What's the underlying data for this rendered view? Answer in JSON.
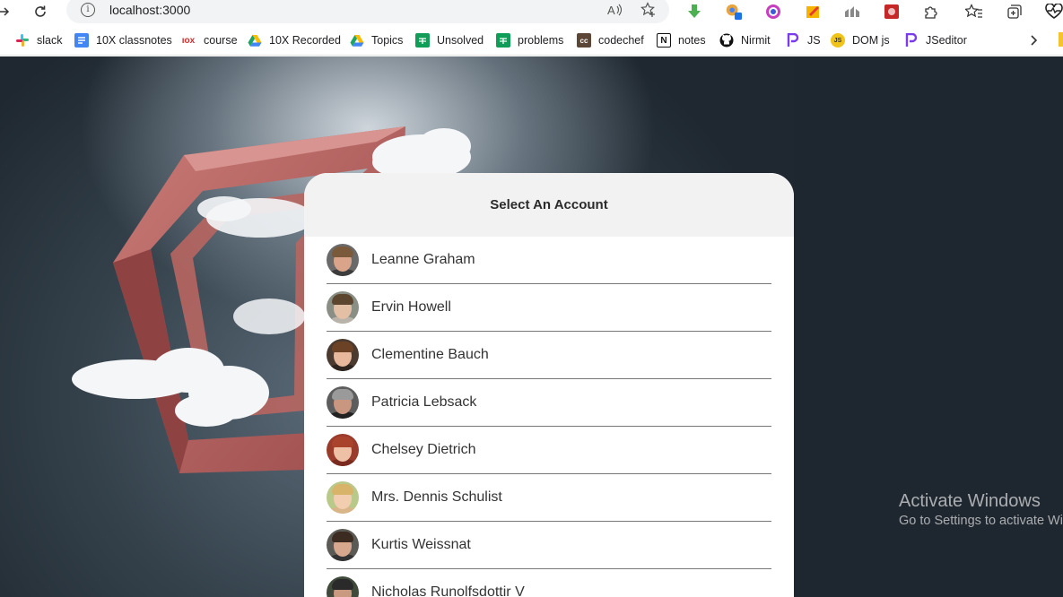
{
  "browser": {
    "url": "localhost:3000",
    "bookmarks": [
      {
        "label": "slack",
        "icon": "slack-icon"
      },
      {
        "label": "10X classnotes",
        "icon": "google-docs-icon"
      },
      {
        "label": "course",
        "icon": "10x-icon"
      },
      {
        "label": "10X Recorded",
        "icon": "google-drive-icon"
      },
      {
        "label": "Topics",
        "icon": "google-drive-icon"
      },
      {
        "label": "Unsolved",
        "icon": "google-sheets-icon"
      },
      {
        "label": "problems",
        "icon": "google-sheets-icon"
      },
      {
        "label": "codechef",
        "icon": "codechef-icon"
      },
      {
        "label": "notes",
        "icon": "notion-icon"
      },
      {
        "label": "Nirmit",
        "icon": "github-icon"
      },
      {
        "label": "JS",
        "icon": "jseditor-icon"
      },
      {
        "label": "DOM js",
        "icon": "js-icon"
      },
      {
        "label": "JSeditor",
        "icon": "jseditor-icon"
      }
    ]
  },
  "card": {
    "title": "Select An Account",
    "accounts": [
      {
        "name": "Leanne Graham"
      },
      {
        "name": "Ervin Howell"
      },
      {
        "name": "Clementine Bauch"
      },
      {
        "name": "Patricia Lebsack"
      },
      {
        "name": "Chelsey Dietrich"
      },
      {
        "name": "Mrs. Dennis Schulist"
      },
      {
        "name": "Kurtis Weissnat"
      },
      {
        "name": "Nicholas Runolfsdottir V"
      }
    ]
  },
  "watermark": {
    "title": "Activate Windows",
    "subtitle": "Go to Settings to activate Windows."
  }
}
